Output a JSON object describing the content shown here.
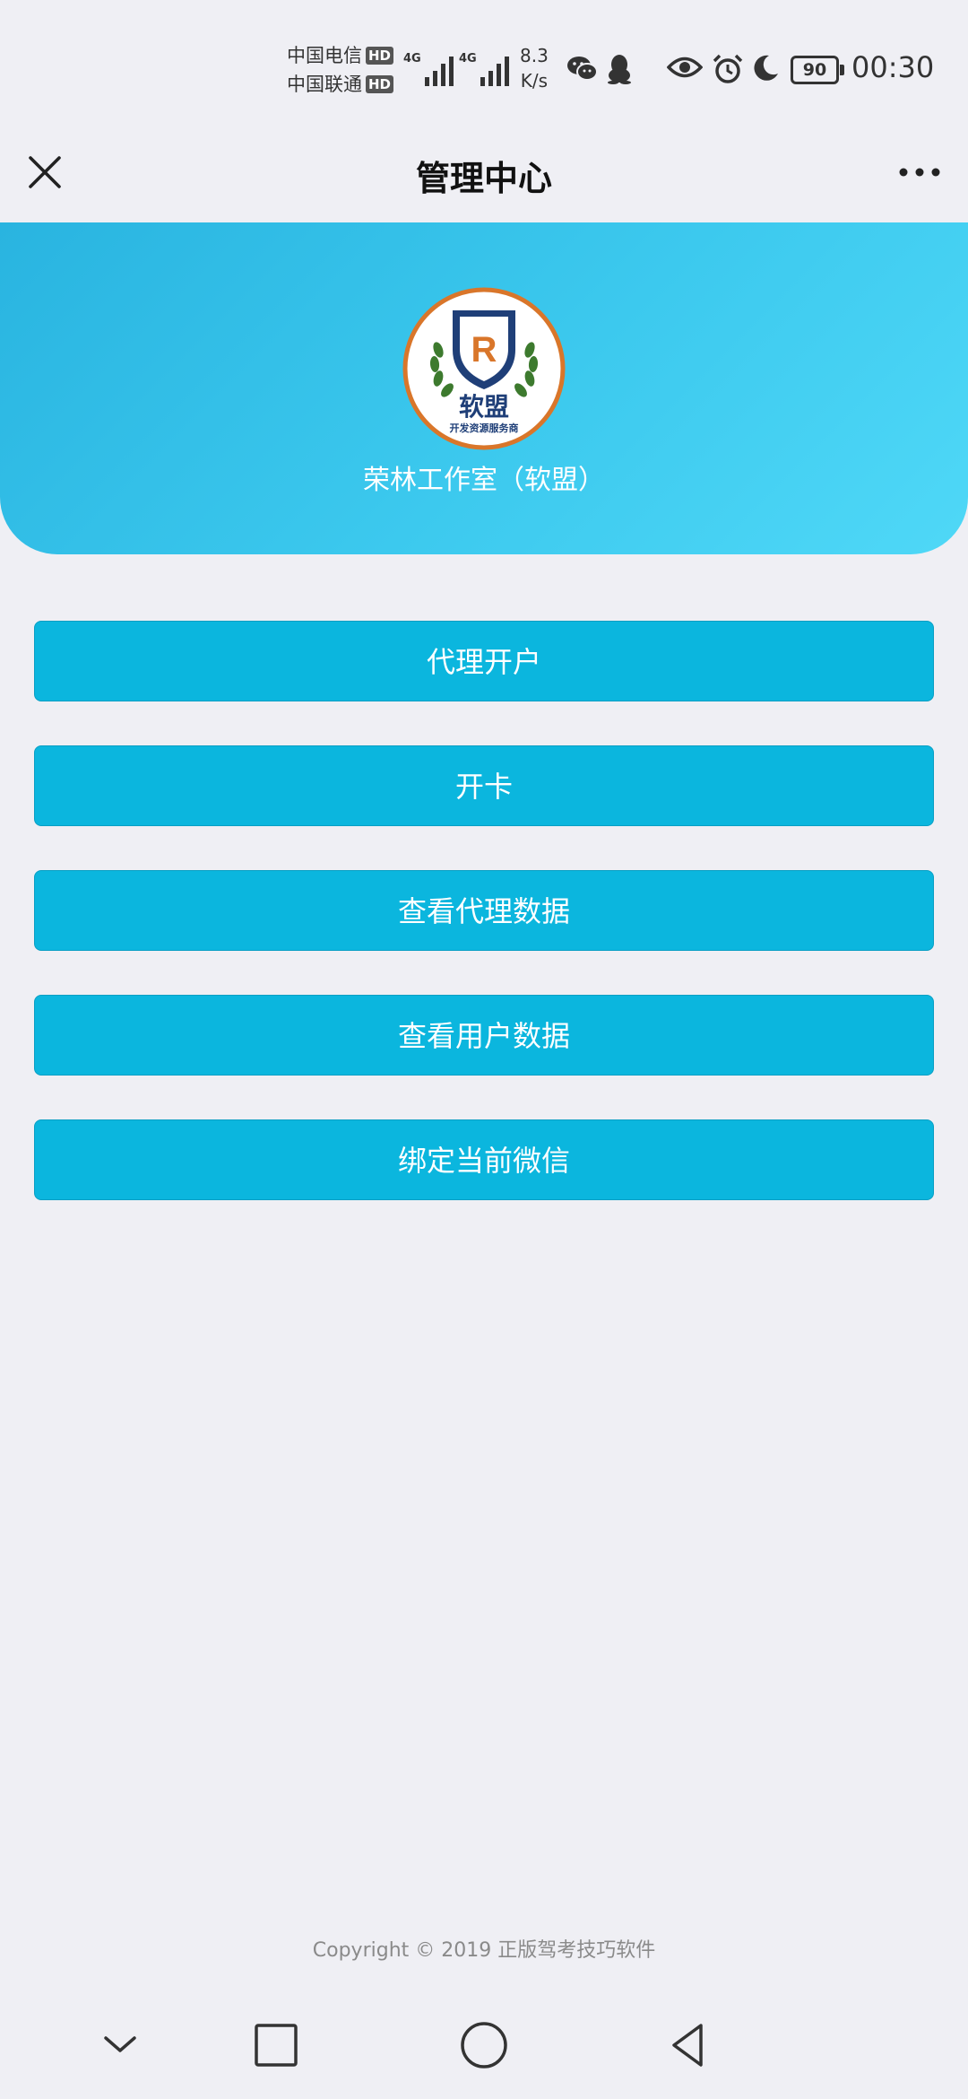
{
  "status_bar": {
    "carrier_1": "中国电信",
    "carrier_2": "中国联通",
    "hd_label": "HD",
    "network_1": "4G",
    "network_2": "4G",
    "speed_value": "8.3",
    "speed_unit": "K/s",
    "battery": "90",
    "time": "00:30",
    "icons": [
      "wechat-icon",
      "qq-icon",
      "eye-icon",
      "alarm-icon",
      "moon-icon"
    ]
  },
  "nav": {
    "title": "管理中心",
    "close_icon": "close-icon",
    "more_icon": "more-icon"
  },
  "header": {
    "logo_text": "软盟",
    "logo_letter": "R",
    "logo_tagline": "开发资源服务商",
    "org_name": "荣林工作室（软盟）",
    "gradient": [
      "#29b4e0",
      "#4fd8f7"
    ]
  },
  "menu": {
    "items": [
      {
        "label": "代理开户"
      },
      {
        "label": "开卡"
      },
      {
        "label": "查看代理数据"
      },
      {
        "label": "查看用户数据"
      },
      {
        "label": "绑定当前微信"
      }
    ],
    "button_color": "#0bb6de"
  },
  "footer": {
    "copyright": "Copyright © 2019 正版驾考技巧软件"
  },
  "system_nav": {
    "icons": [
      "chevron-down-icon",
      "recents-icon",
      "home-icon",
      "back-icon"
    ]
  }
}
